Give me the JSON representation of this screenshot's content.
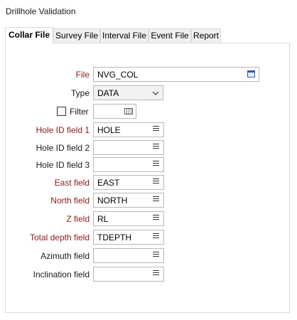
{
  "window": {
    "title": "Drillhole Validation"
  },
  "tabs": [
    {
      "label": "Collar File",
      "active": true
    },
    {
      "label": "Survey File",
      "active": false
    },
    {
      "label": "Interval File",
      "active": false
    },
    {
      "label": "Event File",
      "active": false
    },
    {
      "label": "Report",
      "active": false
    }
  ],
  "form": {
    "file": {
      "label": "File",
      "value": "NVG_COL"
    },
    "type": {
      "label": "Type",
      "value": "DATA"
    },
    "filter": {
      "label": "Filter",
      "checked": false,
      "value": ""
    },
    "fields": [
      {
        "label": "Hole ID field 1",
        "value": "HOLE",
        "required": true
      },
      {
        "label": "Hole ID field 2",
        "value": "",
        "required": false
      },
      {
        "label": "Hole ID field 3",
        "value": "",
        "required": false
      },
      {
        "label": "East field",
        "value": "EAST",
        "required": true
      },
      {
        "label": "North field",
        "value": "NORTH",
        "required": true
      },
      {
        "label": "Z field",
        "value": "RL",
        "required": true
      },
      {
        "label": "Total depth field",
        "value": "TDEPTH",
        "required": true
      },
      {
        "label": "Azimuth field",
        "value": "",
        "required": false
      },
      {
        "label": "Inclination field",
        "value": "",
        "required": false
      }
    ]
  },
  "colors": {
    "required_label": "#8b1a1a",
    "border": "#b8b8b8",
    "tab_bg": "#f0f0f0"
  },
  "icons": {
    "list": "list-icon",
    "file_browse": "file-browse-icon",
    "dropdown": "chevron-down-icon",
    "filter_editor": "keyboard-icon"
  }
}
